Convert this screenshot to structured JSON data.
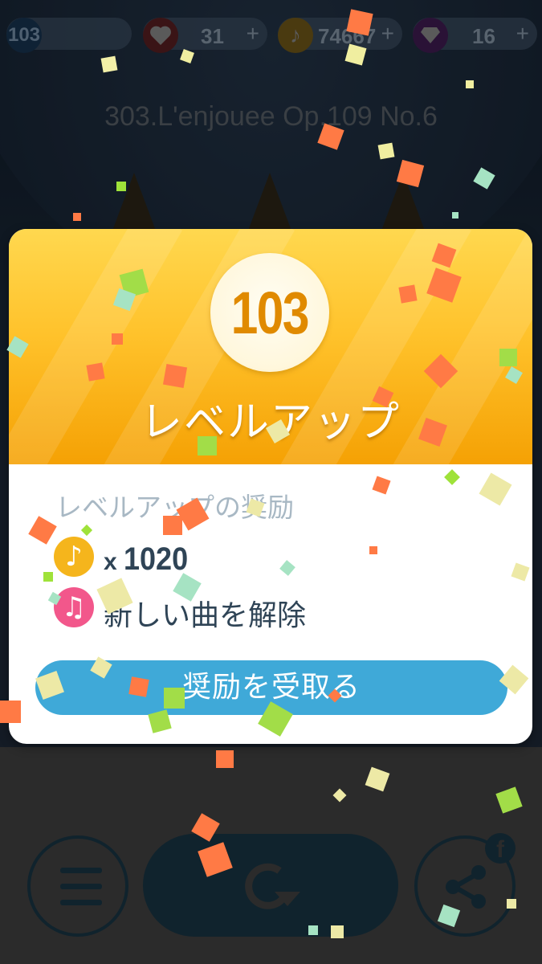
{
  "status_bar": {
    "level": "103",
    "hearts": "31",
    "notes": "74667",
    "gems": "16",
    "plus": "+"
  },
  "song_title": "303.L'enjouee Op.109 No.6",
  "modal": {
    "level": "103",
    "title": "レベルアップ",
    "reward_heading": "レベルアップの奨励",
    "rewards": [
      {
        "icon": "coin-note-icon",
        "prefix": "x",
        "count": "1020"
      },
      {
        "icon": "new-song-icon",
        "text": "新しい曲を解除"
      }
    ],
    "claim_label": "奨励を受取る"
  },
  "bottom_controls": {
    "menu": "menu-icon",
    "replay": "replay-icon",
    "share": "share-icon",
    "facebook_badge": "f"
  },
  "colors": {
    "header_gold": "#ffc22b",
    "level_orange": "#e08a00",
    "claim_blue": "#3fa9d8",
    "coin_yellow": "#f5b51c",
    "note_pink": "#f2578b"
  }
}
